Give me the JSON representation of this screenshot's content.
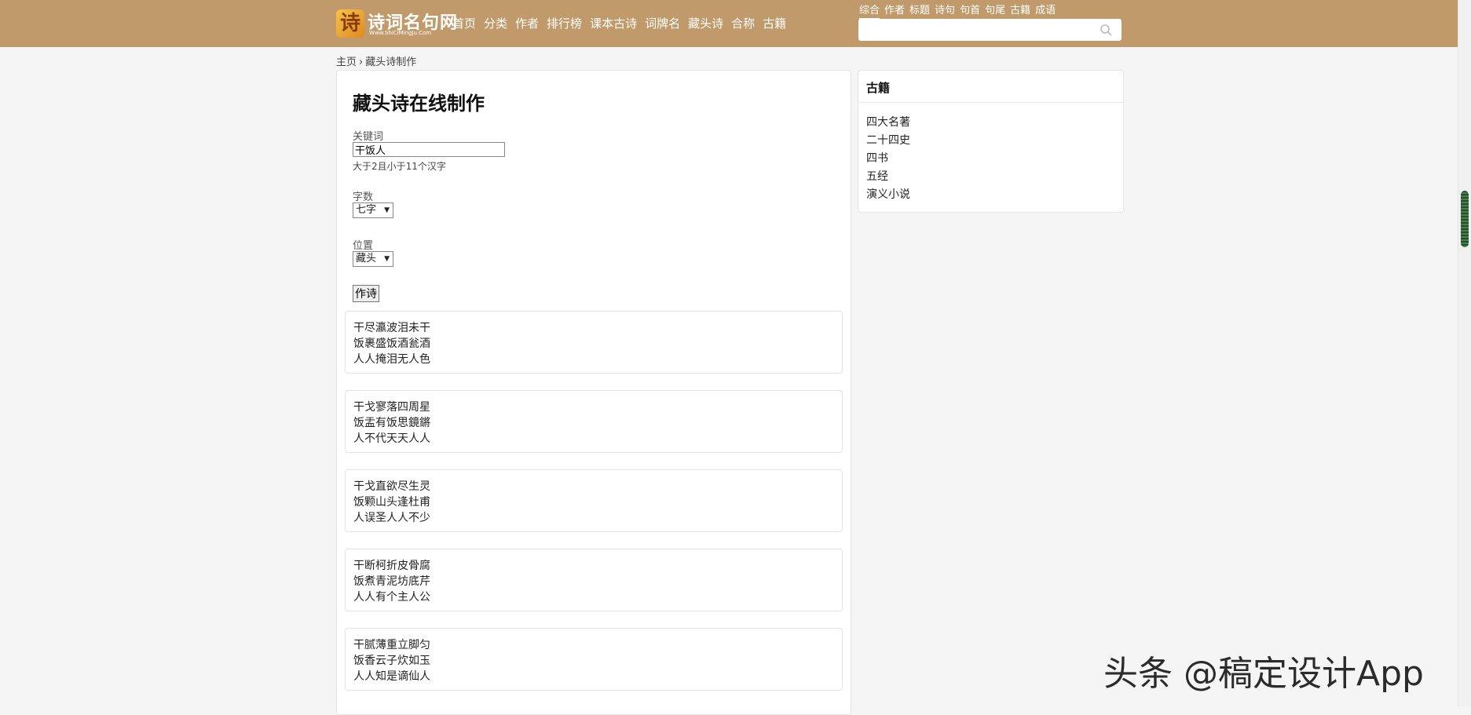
{
  "header": {
    "logo": {
      "name": "诗词名句网",
      "url_text": "Www.ShiCiMingJu.Com"
    },
    "nav": [
      "首页",
      "分类",
      "作者",
      "排行榜",
      "课本古诗",
      "词牌名",
      "藏头诗",
      "合称",
      "古籍"
    ],
    "search_tabs": [
      "综合",
      "作者",
      "标题",
      "诗句",
      "句首",
      "句尾",
      "古籍",
      "成语"
    ],
    "active_search_tab": "综合",
    "search_value": ""
  },
  "breadcrumb": {
    "home": "主页",
    "separator": "›",
    "current": "藏头诗制作"
  },
  "form": {
    "title": "藏头诗在线制作",
    "keyword_label": "关键词",
    "keyword_value": "干饭人",
    "keyword_hint": "大于2且小于11个汉字",
    "count_label": "字数",
    "count_value": "七字",
    "position_label": "位置",
    "position_value": "藏头",
    "submit_label": "作诗"
  },
  "poems": [
    [
      "干尽瀛波泪未干",
      "饭裹盛饭酒瓮酒",
      "人人掩泪无人色"
    ],
    [
      "干戈寥落四周星",
      "饭盂有饭思鏡鏘",
      "人不代天天人人"
    ],
    [
      "干戈直欲尽生灵",
      "饭颗山头逢杜甫",
      "人误圣人人不少"
    ],
    [
      "干断柯折皮骨腐",
      "饭煮青泥坊底芹",
      "人人有个主人公"
    ],
    [
      "干腻薄重立脚匀",
      "饭香云子炊如玉",
      "人人知是谪仙人"
    ]
  ],
  "sidebar": {
    "title": "古籍",
    "links": [
      "四大名著",
      "二十四史",
      "四书",
      "五经",
      "演义小说"
    ]
  },
  "watermark": "头条 @稿定设计App",
  "colors": {
    "topbar": "#c09a6b",
    "page_bg": "#f5f5f5"
  }
}
